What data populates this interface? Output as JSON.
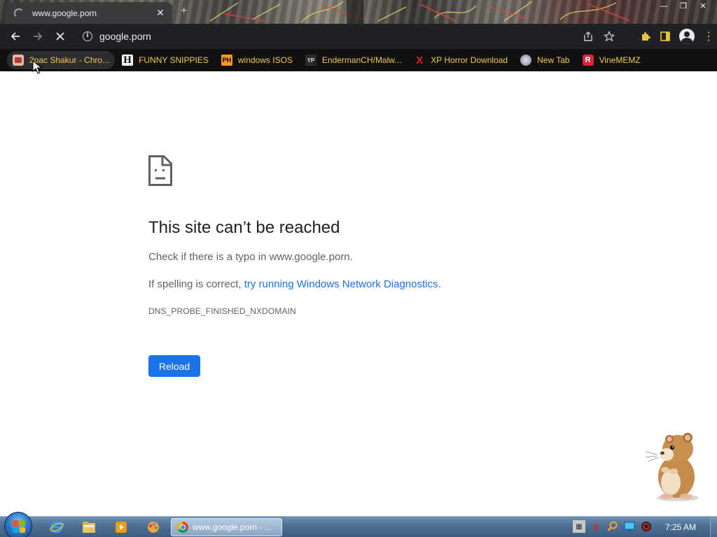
{
  "browser": {
    "tab": {
      "title": "www.google.porn",
      "close_glyph": "✕"
    },
    "new_tab_glyph": "+",
    "window_controls": [
      "—",
      "❐",
      "✕"
    ],
    "omnibox": {
      "url": "google.porn"
    },
    "nav": {
      "back": "←",
      "forward": "→",
      "stop": "✕"
    },
    "bookmarks": [
      {
        "label": "2pac Shakur - Chro...",
        "icon": "2pac-icon",
        "color": "#e5b6a0"
      },
      {
        "label": "FUNNY SNIPPIES",
        "icon": "h-icon",
        "glyph": "H",
        "color": "#ffffff"
      },
      {
        "label": "windows ISOS",
        "icon": "ph-icon",
        "glyph": "PH",
        "color": "#f7971d"
      },
      {
        "label": "EndermanCH/Malw...",
        "icon": "yp-icon",
        "glyph": "YP",
        "color": "#555555"
      },
      {
        "label": "XP Horror Download",
        "icon": "x-icon",
        "glyph": "X",
        "color": "#e02020"
      },
      {
        "label": "New Tab",
        "icon": "globe-icon",
        "color": "#b9b9c9"
      },
      {
        "label": "VineMEMZ",
        "icon": "r-icon",
        "glyph": "R",
        "color": "#d6283d"
      }
    ]
  },
  "page": {
    "title": "This site can’t be reached",
    "line1": "Check if there is a typo in www.google.porn.",
    "line2_prefix": "If spelling is correct, ",
    "line2_link": "try running Windows Network Diagnostics",
    "line2_suffix": ".",
    "error_code": "DNS_PROBE_FINISHED_NXDOMAIN",
    "reload_label": "Reload",
    "accent_color": "#1a73e8"
  },
  "taskbar": {
    "active_task_label": "www.google.porn - ...",
    "clock": "7:25 AM"
  }
}
